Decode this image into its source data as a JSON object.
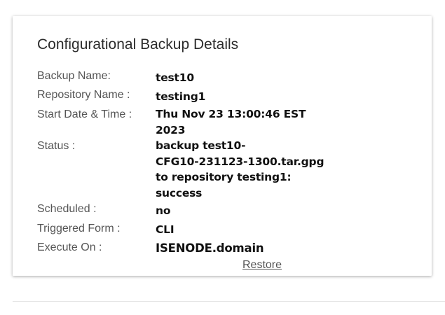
{
  "title": "Configurational Backup Details",
  "fields": {
    "backup_name": {
      "label": "Backup Name:",
      "value": "test10"
    },
    "repository_name": {
      "label": "Repository Name :",
      "value": "testing1"
    },
    "start_date_time": {
      "label": "Start Date & Time :",
      "value_lines": [
        "Thu Nov 23 13:00:46 EST",
        "2023"
      ]
    },
    "status": {
      "label": "Status :",
      "value_lines": [
        "backup test10-",
        "CFG10-231123-1300.tar.gpg",
        "to repository testing1:",
        "success"
      ]
    },
    "scheduled": {
      "label": "Scheduled :",
      "value": "no"
    },
    "triggered_form": {
      "label": "Triggered Form :",
      "value": "CLI"
    },
    "execute_on": {
      "label": "Execute On :",
      "value": "ISENODE.domain"
    }
  },
  "actions": {
    "restore_label": "Restore"
  },
  "colors": {
    "label": "#555555",
    "value": "#111111",
    "link": "#555555"
  }
}
